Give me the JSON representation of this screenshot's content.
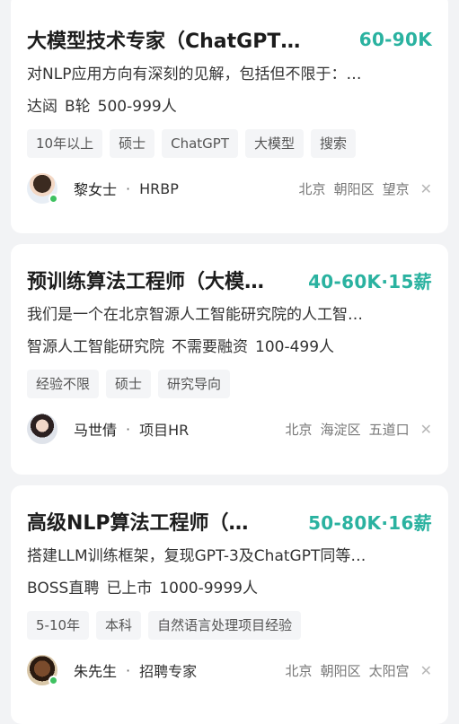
{
  "jobs": [
    {
      "title": "大模型技术专家（ChatGPT…",
      "salary": "60-90K",
      "description": "对NLP应用方向有深刻的见解，包括但不限于：…",
      "company": "达闼",
      "stage": "B轮",
      "size": "500-999人",
      "tags": [
        "10年以上",
        "硕士",
        "ChatGPT",
        "大模型",
        "搜索"
      ],
      "recruiter": {
        "name": "黎女士",
        "role": "HRBP"
      },
      "location": {
        "city": "北京",
        "district": "朝阳区",
        "area": "望京"
      }
    },
    {
      "title": "预训练算法工程师（大模…",
      "salary": "40-60K·15薪",
      "description": "我们是一个在北京智源人工智能研究院的人工智…",
      "company": "智源人工智能研究院",
      "stage": "不需要融资",
      "size": "100-499人",
      "tags": [
        "经验不限",
        "硕士",
        "研究导向"
      ],
      "recruiter": {
        "name": "马世倩",
        "role": "项目HR"
      },
      "location": {
        "city": "北京",
        "district": "海淀区",
        "area": "五道口"
      }
    },
    {
      "title": "高级NLP算法工程师（…",
      "salary": "50-80K·16薪",
      "description": "搭建LLM训练框架，复现GPT-3及ChatGPT同等…",
      "company": "BOSS直聘",
      "stage": "已上市",
      "size": "1000-9999人",
      "tags": [
        "5-10年",
        "本科",
        "自然语言处理项目经验"
      ],
      "recruiter": {
        "name": "朱先生",
        "role": "招聘专家"
      },
      "location": {
        "city": "北京",
        "district": "朝阳区",
        "area": "太阳宫"
      }
    }
  ],
  "ui": {
    "separator": "·",
    "close_glyph": "✕"
  }
}
